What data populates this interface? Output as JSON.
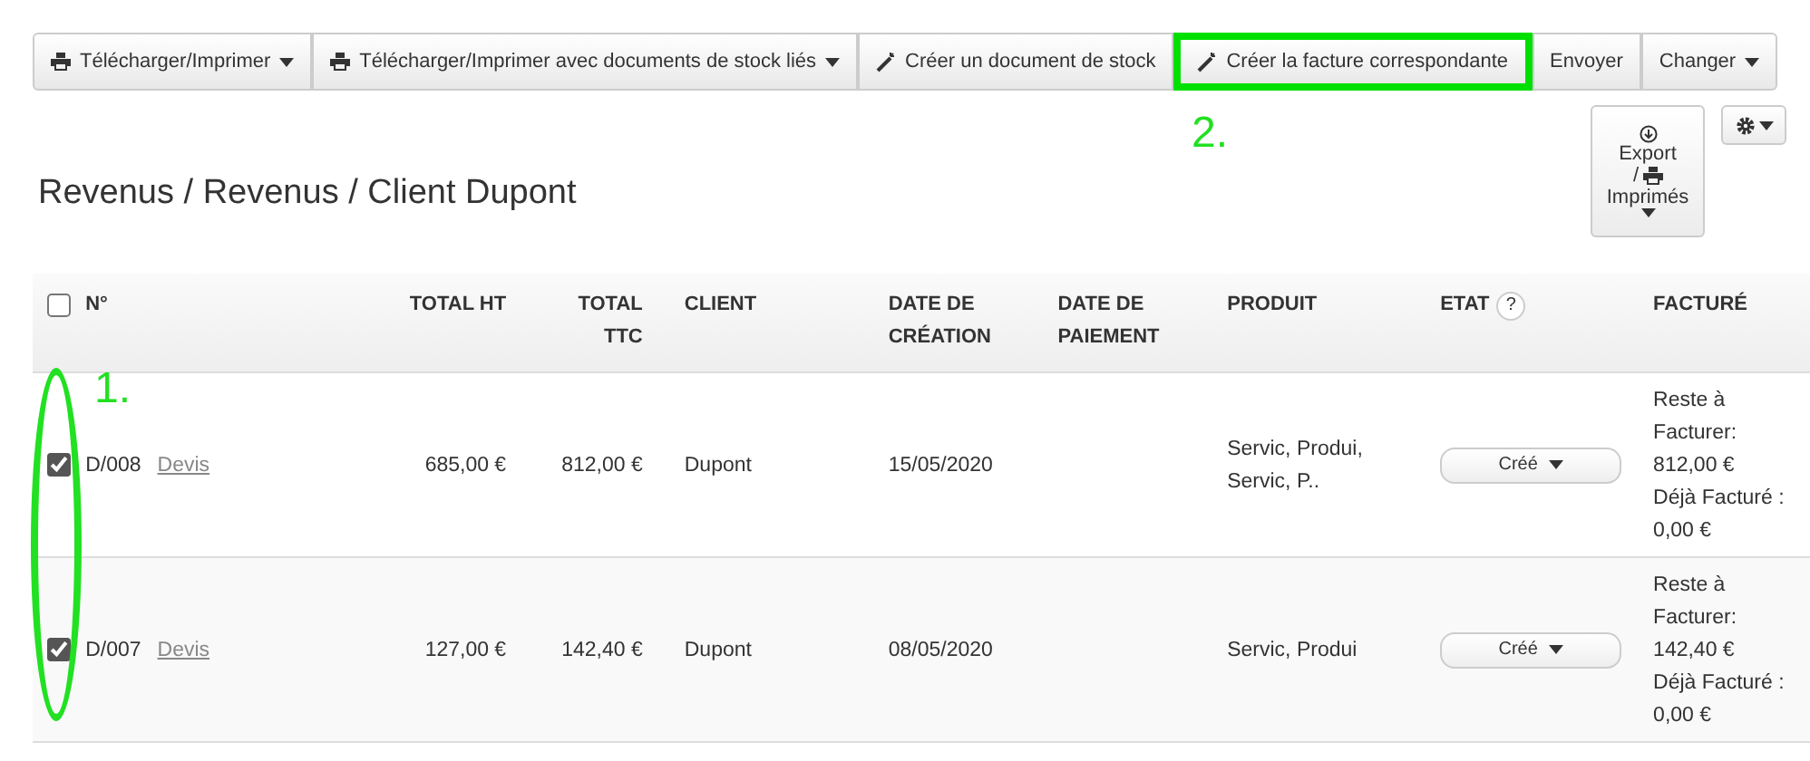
{
  "toolbar": [
    {
      "label": "Télécharger/Imprimer",
      "kind": "print",
      "caret": true,
      "highlighted": false
    },
    {
      "label": "Télécharger/Imprimer avec documents de stock liés",
      "kind": "print",
      "caret": true,
      "highlighted": false
    },
    {
      "label": "Créer un document de stock",
      "kind": "create",
      "caret": false,
      "highlighted": false
    },
    {
      "label": "Créer la facture correspondante",
      "kind": "create",
      "caret": false,
      "highlighted": true
    },
    {
      "label": "Envoyer",
      "kind": "plain",
      "caret": false,
      "highlighted": false
    },
    {
      "label": "Changer",
      "kind": "plain",
      "caret": true,
      "highlighted": false
    }
  ],
  "annotations": [
    {
      "label": "2."
    },
    {
      "label": "1."
    }
  ],
  "title": "Revenus / Revenus / Client Dupont",
  "export_button": {
    "line_1": "Export",
    "line_2": "/",
    "line_3": "Imprimés"
  },
  "table": {
    "select_all": {
      "checked": false
    },
    "columns": [
      {
        "label": "N°"
      },
      {
        "label": "TOTAL HT"
      },
      {
        "label": "TOTAL TTC"
      },
      {
        "label": "CLIENT"
      },
      {
        "label": "DATE DE CRÉATION"
      },
      {
        "label": "DATE DE PAIEMENT"
      },
      {
        "label": "PRODUIT"
      },
      {
        "label": "ETAT",
        "help": "?"
      },
      {
        "label": "FACTURÉ"
      }
    ],
    "rows": [
      {
        "checked": true,
        "number": "D/008",
        "type": "Devis",
        "total_ht": "685,00 €",
        "total_ttc": "812,00 €",
        "client": "Dupont",
        "date_creation": "15/05/2020",
        "date_paiement": "",
        "produit": "Servic, Produi, Servic, P..",
        "etat": "Créé",
        "facture": [
          "Reste à Facturer:",
          "812,00 €",
          "Déjà Facturé :",
          "0,00 €"
        ]
      },
      {
        "checked": true,
        "number": "D/007",
        "type": "Devis",
        "total_ht": "127,00 €",
        "total_ttc": "142,40 €",
        "client": "Dupont",
        "date_creation": "08/05/2020",
        "date_paiement": "",
        "produit": "Servic, Produi",
        "etat": "Créé",
        "facture": [
          "Reste à Facturer:",
          "142,40 €",
          "Déjà Facturé :",
          "0,00 €"
        ]
      }
    ]
  }
}
